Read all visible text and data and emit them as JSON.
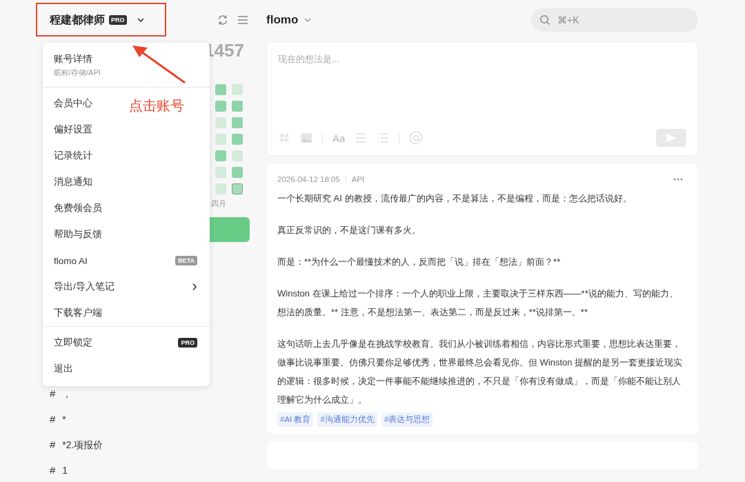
{
  "sidebar": {
    "account": {
      "name": "程建都律师",
      "badge": "PRO"
    },
    "stats": {
      "count": "1457"
    },
    "heatmap": {
      "columns": [
        {
          "cells": [
            {
              "color": "#8fd4a8",
              "today": false
            },
            {
              "color": "#8fd4a8",
              "today": false
            },
            {
              "color": "#d5eadb",
              "today": false
            },
            {
              "color": "#d5eadb",
              "today": false
            },
            {
              "color": "#8fd4a8",
              "today": false
            },
            {
              "color": "#d5eadb",
              "today": false
            },
            {
              "color": "#d5eadb",
              "today": false
            }
          ]
        },
        {
          "cells": [
            {
              "color": "#d5eadb",
              "today": false
            },
            {
              "color": "#8fd4a8",
              "today": false
            },
            {
              "color": "#8fd4a8",
              "today": false
            },
            {
              "color": "#8fd4a8",
              "today": false
            },
            {
              "color": "#d5eadb",
              "today": false
            },
            {
              "color": "#8fd4a8",
              "today": false
            },
            {
              "color": "#a8dcbb",
              "today": true
            }
          ]
        }
      ],
      "month": "四月"
    },
    "tags": [
      {
        "hash": "#",
        "label": "，"
      },
      {
        "hash": "#",
        "label": "*"
      },
      {
        "hash": "#",
        "label": "*2.项报价"
      },
      {
        "hash": "#",
        "label": "1"
      }
    ]
  },
  "menu": {
    "groups": [
      [
        {
          "kind": "header",
          "label": "账号详情",
          "sublabel": "昵称/存储/API"
        }
      ],
      [
        {
          "kind": "plain",
          "label": "会员中心"
        },
        {
          "kind": "plain",
          "label": "偏好设置"
        },
        {
          "kind": "plain",
          "label": "记录统计"
        },
        {
          "kind": "plain",
          "label": "消息通知"
        },
        {
          "kind": "plain",
          "label": "免费领会员"
        },
        {
          "kind": "plain",
          "label": "帮助与反馈"
        },
        {
          "kind": "beta",
          "label": "flomo AI",
          "badge": "BETA"
        },
        {
          "kind": "submenu",
          "label": "导出/导入笔记"
        },
        {
          "kind": "plain",
          "label": "下载客户端"
        }
      ],
      [
        {
          "kind": "pro",
          "label": "立即锁定",
          "badge": "PRO"
        },
        {
          "kind": "plain",
          "label": "退出"
        }
      ]
    ]
  },
  "annotation": {
    "label": "点击账号"
  },
  "main": {
    "title": "flomo",
    "search": {
      "placeholder": "⌘+K"
    },
    "composer": {
      "placeholder": "现在的想法是...",
      "format_label": "Aa"
    },
    "note": {
      "date": "2026-04-12 18:05",
      "source": "API",
      "paragraphs": [
        "一个长期研究 AI 的教授，流传最广的内容，不是算法，不是编程，而是：怎么把话说好。",
        "真正反常识的，不是这门课有多火。",
        "而是：**为什么一个最懂技术的人，反而把「说」排在「想法」前面？**",
        "Winston 在课上给过一个排序：一个人的职业上限，主要取决于三样东西——**说的能力、写的能力、想法的质量。** 注意，不是想法第一、表达第二，而是反过来，**说排第一。**",
        "这句话听上去几乎像是在挑战学校教育。我们从小被训练着相信，内容比形式重要，思想比表达重要，做事比说事重要。仿佛只要你足够优秀，世界最终总会看见你。但 Winston 提醒的是另一套更接近现实的逻辑：很多时候，决定一件事能不能继续推进的，不只是「你有没有做成」，而是「你能不能让别人理解它为什么成立」。"
      ],
      "tags": [
        "#AI 教育",
        "#沟通能力优先",
        "#表达与思想"
      ]
    }
  }
}
